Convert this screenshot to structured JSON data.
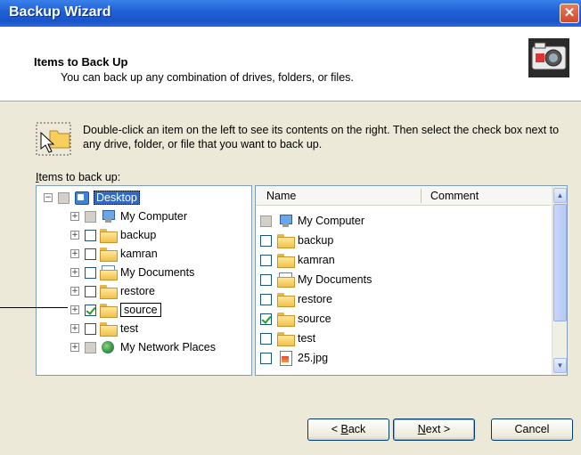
{
  "window": {
    "title": "Backup Wizard",
    "close_symbol": "✕"
  },
  "header": {
    "title": "Items to Back Up",
    "subtitle": "You can back up any combination of drives, folders, or files.",
    "icon": "backup-camera-icon"
  },
  "instructions": {
    "text": "Double-click an item on the left to see its contents on the right. Then select the check box next to any drive, folder, or file that you want to back up.",
    "icon": "pointer-folder-icon"
  },
  "tree": {
    "label_accel": "I",
    "label_rest": "tems to back up:",
    "items": [
      {
        "label": "Desktop",
        "expander": "−",
        "icon": "desktop-icon",
        "checkbox": "gray"
      },
      {
        "label": "My Computer",
        "expander": "+",
        "icon": "computer-icon",
        "checkbox": "gray"
      },
      {
        "label": "backup",
        "expander": "+",
        "icon": "folder-icon",
        "checkbox": "unchecked"
      },
      {
        "label": "kamran",
        "expander": "+",
        "icon": "folder-icon",
        "checkbox": "unchecked"
      },
      {
        "label": "My Documents",
        "expander": "+",
        "icon": "documents-icon",
        "checkbox": "unchecked"
      },
      {
        "label": "restore",
        "expander": "+",
        "icon": "folder-icon",
        "checkbox": "unchecked"
      },
      {
        "label": "source",
        "expander": "+",
        "icon": "folder-icon",
        "checkbox": "checked"
      },
      {
        "label": "test",
        "expander": "+",
        "icon": "folder-icon",
        "checkbox": "unchecked"
      },
      {
        "label": "My Network Places",
        "expander": "+",
        "icon": "network-icon",
        "checkbox": "gray"
      }
    ]
  },
  "list": {
    "columns": [
      "Name",
      "Comment"
    ],
    "items": [
      {
        "name": "My Computer",
        "icon": "computer-icon",
        "checkbox": "gray"
      },
      {
        "name": "backup",
        "icon": "folder-icon",
        "checkbox": "unchecked"
      },
      {
        "name": "kamran",
        "icon": "folder-icon",
        "checkbox": "unchecked"
      },
      {
        "name": "My Documents",
        "icon": "documents-icon",
        "checkbox": "unchecked"
      },
      {
        "name": "restore",
        "icon": "folder-icon",
        "checkbox": "unchecked"
      },
      {
        "name": "source",
        "icon": "folder-icon",
        "checkbox": "checked"
      },
      {
        "name": "test",
        "icon": "folder-icon",
        "checkbox": "unchecked"
      },
      {
        "name": "25.jpg",
        "icon": "jpg-icon",
        "checkbox": "unchecked"
      }
    ],
    "scroll_up": "▲",
    "scroll_down": "▼"
  },
  "buttons": {
    "back_prefix": "< ",
    "back_accel": "B",
    "back_rest": "ack",
    "next_accel": "N",
    "next_rest": "ext >",
    "cancel": "Cancel"
  }
}
